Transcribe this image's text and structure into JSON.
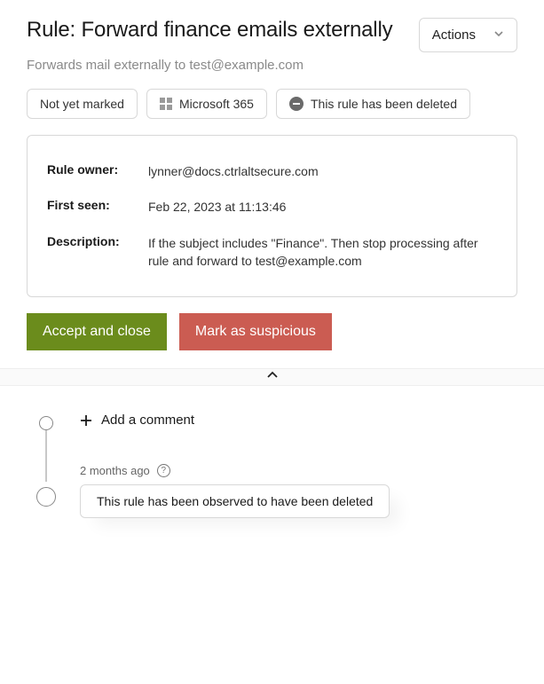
{
  "header": {
    "title": "Rule: Forward finance emails externally",
    "subtitle": "Forwards mail externally to test@example.com",
    "actions_label": "Actions"
  },
  "badges": {
    "status": "Not yet marked",
    "platform": "Microsoft 365",
    "deleted": "This rule has been deleted"
  },
  "details": {
    "owner_label": "Rule owner:",
    "owner_value": "lynner@docs.ctrlaltsecure.com",
    "first_seen_label": "First seen:",
    "first_seen_value": "Feb 22, 2023 at 11:13:46",
    "description_label": "Description:",
    "description_value": "If the subject includes \"Finance\". Then stop processing after rule and forward to test@example.com"
  },
  "buttons": {
    "accept": "Accept and close",
    "suspicious": "Mark as suspicious"
  },
  "timeline": {
    "add_comment": "Add a comment",
    "event_time": "2 months ago",
    "event_text": "This rule has been observed to have been deleted"
  },
  "colors": {
    "accept_bg": "#6b8c1c",
    "suspicious_bg": "#cb5c52"
  }
}
